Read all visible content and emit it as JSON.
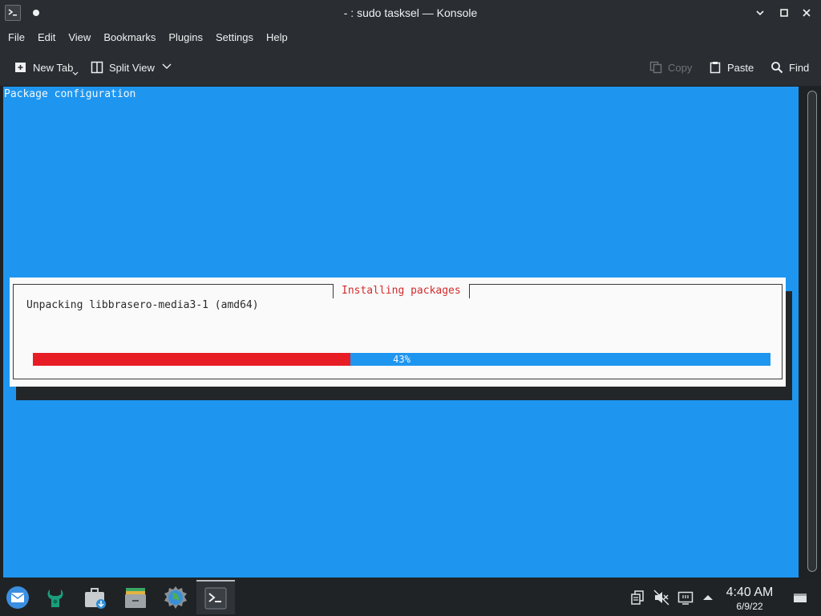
{
  "window": {
    "title": "- : sudo tasksel — Konsole"
  },
  "menubar": {
    "items": [
      "File",
      "Edit",
      "View",
      "Bookmarks",
      "Plugins",
      "Settings",
      "Help"
    ]
  },
  "toolbar": {
    "new_tab": "New Tab",
    "split_view": "Split View",
    "copy": "Copy",
    "paste": "Paste",
    "find": "Find"
  },
  "terminal": {
    "header": "Package configuration",
    "dialog": {
      "title": "Installing packages",
      "message": "Unpacking libbrasero-media3-1 (amd64)",
      "progress_percent": 43,
      "progress_label": "43%"
    },
    "colors": {
      "background": "#1e96f0",
      "dialog_bg": "#fafafa",
      "progress_fill": "#e81c24",
      "title_color": "#d22c2c"
    }
  },
  "taskbar": {
    "launchers": [
      "mail-icon",
      "software-center-icon",
      "store-icon",
      "files-icon",
      "browser-icon",
      "konsole-icon"
    ],
    "time": "4:40 AM",
    "date": "6/9/22"
  }
}
